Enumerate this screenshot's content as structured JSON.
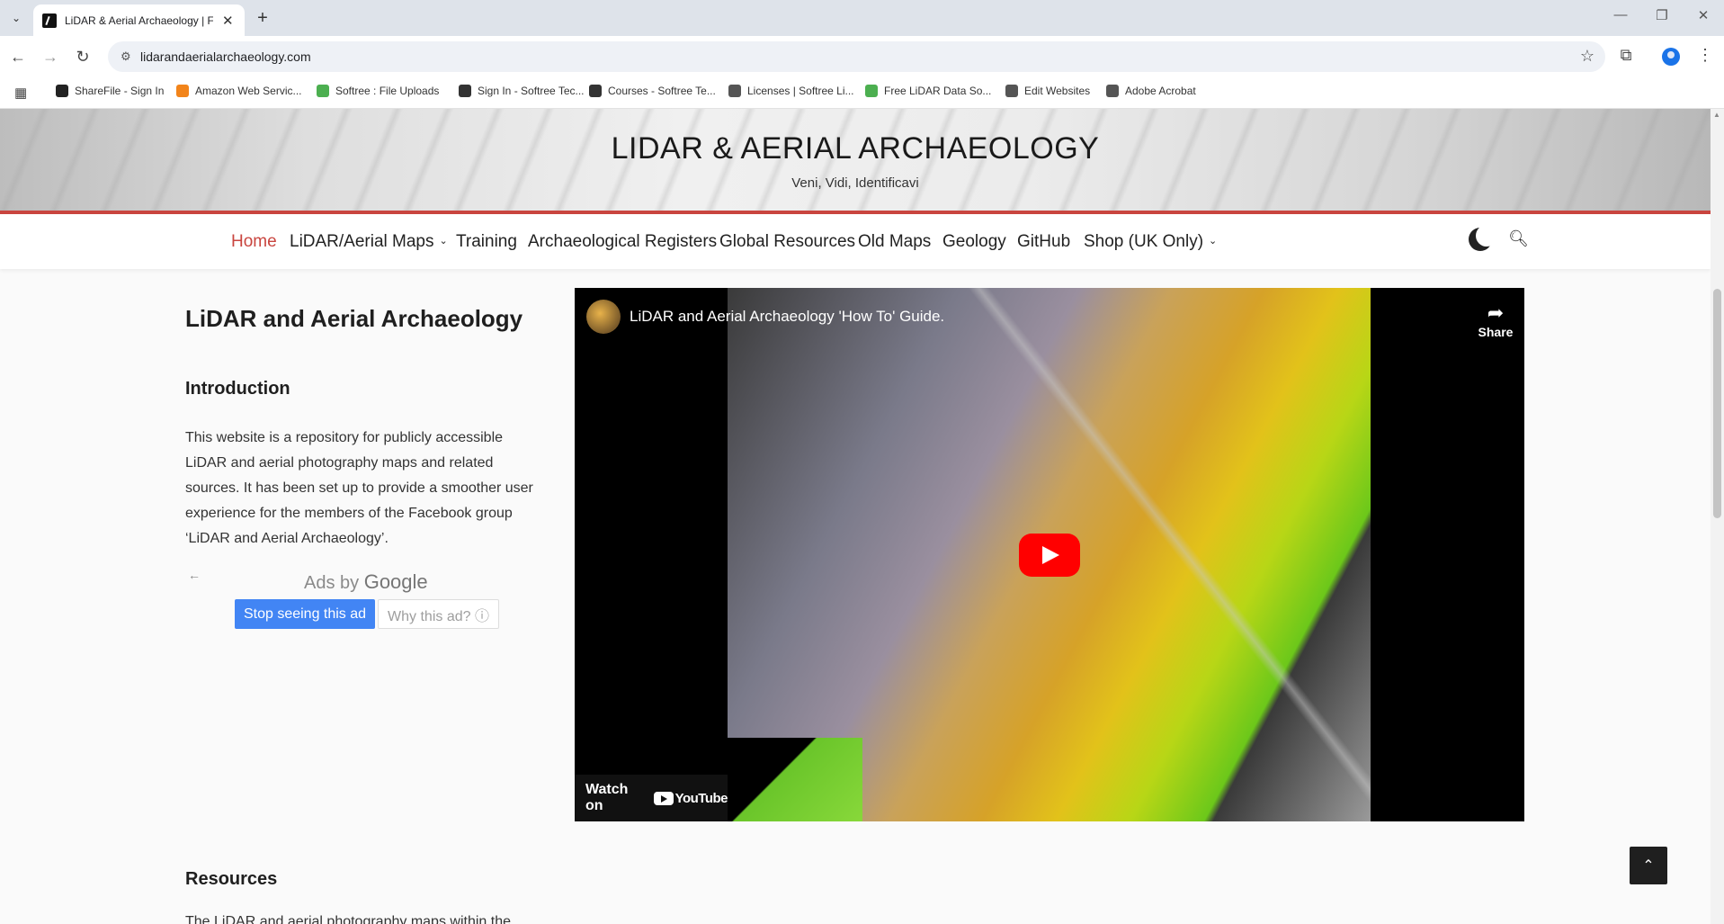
{
  "browser": {
    "tab_title": "LiDAR & Aerial Archaeology | Fr",
    "tab_close": "✕",
    "new_tab": "+",
    "url": "lidarandaerialarchaeology.com",
    "bookmarks": [
      {
        "label": "ShareFile - Sign In",
        "color": "#222222"
      },
      {
        "label": "Amazon Web Servic...",
        "color": "#f2841a"
      },
      {
        "label": "Softree : File Uploads",
        "color": "#4caf50"
      },
      {
        "label": "Sign In - Softree Tec...",
        "color": "#333333"
      },
      {
        "label": "Courses - Softree Te...",
        "color": "#333333"
      },
      {
        "label": "Licenses | Softree Li...",
        "color": "#555555"
      },
      {
        "label": "Free LiDAR Data So...",
        "color": "#4caf50"
      },
      {
        "label": "Edit Websites",
        "color": "#555555"
      },
      {
        "label": "Adobe Acrobat",
        "color": "#555555"
      }
    ]
  },
  "site": {
    "title": "LIDAR & AERIAL ARCHAEOLOGY",
    "tagline": "Veni, Vidi, Identificavi",
    "accent_color": "#c9453f",
    "nav": [
      {
        "label": "Home",
        "active": true
      },
      {
        "label": "LiDAR/Aerial Maps",
        "dropdown": true
      },
      {
        "label": "Training"
      },
      {
        "label": "Archaeological Registers"
      },
      {
        "label": "Global Resources"
      },
      {
        "label": "Old Maps"
      },
      {
        "label": "Geology"
      },
      {
        "label": "GitHub"
      },
      {
        "label": "Shop (UK Only)",
        "dropdown": true
      }
    ]
  },
  "content": {
    "heading": "LiDAR and Aerial Archaeology",
    "intro_heading": "Introduction",
    "intro_text": "This website is a repository for publicly accessible LiDAR and aerial photography maps and related sources. It has been set up to provide a smoother user experience for the members of the Facebook group ‘LiDAR and Aerial Archaeology’.",
    "ads": {
      "ads_by": "Ads by ",
      "google": "Google",
      "stop_label": "Stop seeing this ad",
      "why_label": "Why this ad? ⓘ"
    },
    "video": {
      "title": "LiDAR and Aerial Archaeology 'How To' Guide.",
      "share_label": "Share",
      "watch_on": "Watch on",
      "youtube": "YouTube"
    },
    "resources_heading": "Resources",
    "resources_text_cut": "The LiDAR and aerial photography maps within the"
  }
}
